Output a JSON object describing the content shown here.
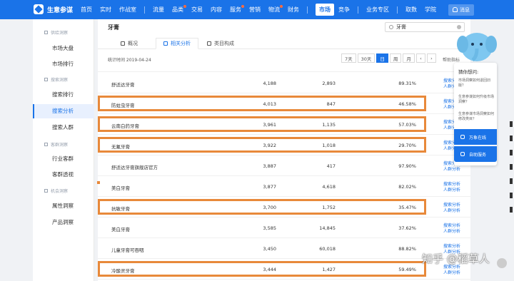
{
  "app": {
    "brand": "生意参谋"
  },
  "nav": {
    "items": [
      "首页",
      "实时",
      "作战室",
      "流量",
      "品类",
      "交易",
      "内容",
      "服务",
      "营销",
      "物流",
      "财务",
      "市场",
      "竞争",
      "业务专区",
      "取数",
      "学院"
    ],
    "active": "市场",
    "message_label": "消息"
  },
  "sidebar": {
    "groups": [
      {
        "title": "供给洞察",
        "items": [
          "市场大盘",
          "市场排行"
        ]
      },
      {
        "title": "搜索洞察",
        "items": [
          "搜索排行",
          "搜索分析",
          "搜索人群"
        ]
      },
      {
        "title": "客群洞察",
        "items": [
          "行业客群",
          "客群透视"
        ]
      },
      {
        "title": "机会洞察",
        "items": [
          "属性洞察",
          "产品洞察"
        ]
      }
    ],
    "active": "搜索分析"
  },
  "main": {
    "title": "牙膏",
    "search_value": "牙膏",
    "tabs": [
      "概况",
      "相关分析",
      "类目构成"
    ],
    "active_tab": "相关分析",
    "stat_time": "统计时间 2019-04-24",
    "ranges": [
      "7天",
      "30天",
      "日",
      "周",
      "月"
    ],
    "active_range": "日",
    "more_label": "帮助指标"
  },
  "table": {
    "rows": [
      {
        "name": "舒适达牙膏",
        "v1": "4,188",
        "v2": "2,893",
        "v3": "89.31%",
        "action1": "搜索分析",
        "action2": "人群分析",
        "highlight": false
      },
      {
        "name": "防蛀虫牙膏",
        "v1": "4,013",
        "v2": "847",
        "v3": "46.58%",
        "action1": "搜索分析",
        "action2": "人群分析",
        "highlight": true
      },
      {
        "name": "云南白药牙膏",
        "v1": "3,961",
        "v2": "1,135",
        "v3": "57.03%",
        "action1": "搜索分析",
        "action2": "人群分析",
        "highlight": true
      },
      {
        "name": "无氟牙膏",
        "v1": "3,922",
        "v2": "1,018",
        "v3": "29.70%",
        "action1": "搜索分析",
        "action2": "人群分析",
        "highlight": true
      },
      {
        "name": "舒适达牙膏旗舰店官方",
        "v1": "3,887",
        "v2": "417",
        "v3": "97.90%",
        "action1": "搜索分析",
        "action2": "人群分析",
        "highlight": false
      },
      {
        "name": "美白牙膏",
        "v1": "3,877",
        "v2": "4,618",
        "v3": "82.02%",
        "action1": "搜索分析",
        "action2": "人群分析",
        "highlight": false
      },
      {
        "name": "抗敏牙膏",
        "v1": "3,700",
        "v2": "1,752",
        "v3": "35.47%",
        "action1": "搜索分析",
        "action2": "人群分析",
        "highlight": true
      },
      {
        "name": "美白牙膏",
        "v1": "3,585",
        "v2": "14,845",
        "v3": "37.62%",
        "action1": "搜索分析",
        "action2": "人群分析",
        "highlight": false
      },
      {
        "name": "儿童牙膏可吞咽",
        "v1": "3,450",
        "v2": "60,018",
        "v3": "88.82%",
        "action1": "搜索分析",
        "action2": "人群分析",
        "highlight": false
      },
      {
        "name": "冷酸灵牙膏",
        "v1": "3,444",
        "v2": "1,427",
        "v3": "59.49%",
        "action1": "搜索分析",
        "action2": "人群分析",
        "highlight": true
      }
    ]
  },
  "help": {
    "title": "猜你想问:",
    "questions": [
      "市场洞察如何退回旧版？",
      "生意参谋如何升级市场洞察？",
      "生意参谋市场洞察如何修改类目？"
    ],
    "buttons": [
      "万象在线",
      "自助服务"
    ]
  },
  "watermark": "知乎 @稻草人"
}
